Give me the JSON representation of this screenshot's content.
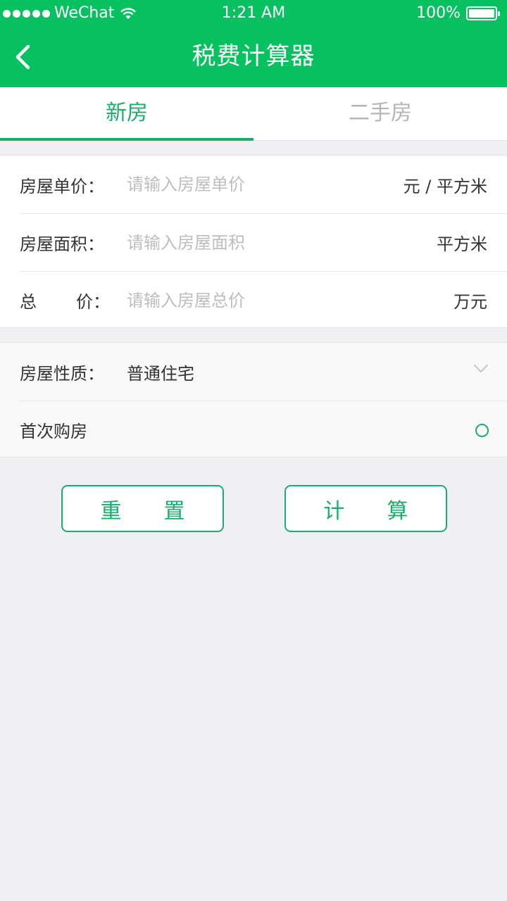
{
  "status_bar": {
    "carrier": "WeChat",
    "time": "1:21 AM",
    "battery": "100%"
  },
  "nav": {
    "title": "税费计算器",
    "back_icon": "chevron-left-icon"
  },
  "tabs": [
    {
      "label": "新房",
      "active": true
    },
    {
      "label": "二手房",
      "active": false
    }
  ],
  "form": {
    "unit_price": {
      "label": "房屋单价：",
      "placeholder": "请输入房屋单价",
      "unit": "元 / 平方米"
    },
    "area": {
      "label": "房屋面积：",
      "placeholder": "请输入房屋面积",
      "unit": "平方米"
    },
    "total": {
      "label_first": "总",
      "label_last": "价：",
      "placeholder": "请输入房屋总价",
      "unit": "万元"
    },
    "property_type": {
      "label": "房屋性质：",
      "value": "普通住宅"
    },
    "first_purchase": {
      "label": "首次购房",
      "checked": false
    }
  },
  "buttons": {
    "reset": "重置",
    "calculate": "计算"
  },
  "colors": {
    "brand": "#07c160",
    "accent": "#1aad6b",
    "background": "#efeff4"
  }
}
